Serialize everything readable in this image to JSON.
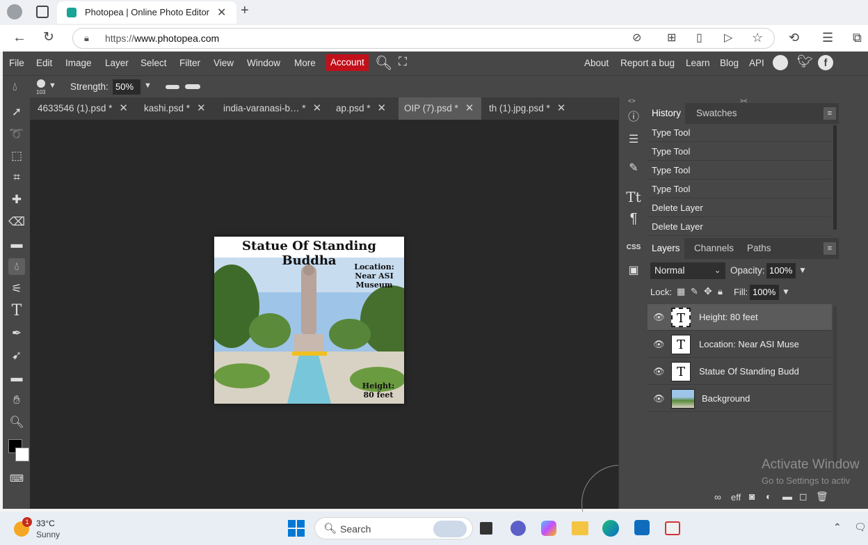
{
  "browser": {
    "tab_title": "Photopea | Online Photo Editor",
    "url_prefix": "https://",
    "url_domain": "www.photopea.com"
  },
  "menubar": {
    "items": [
      "File",
      "Edit",
      "Image",
      "Layer",
      "Select",
      "Filter",
      "View",
      "Window",
      "More"
    ],
    "account": "Account",
    "right_links": [
      "About",
      "Report a bug",
      "Learn",
      "Blog",
      "API"
    ]
  },
  "options": {
    "brush_size": "103",
    "strength_label": "Strength:",
    "strength_value": "50%"
  },
  "doc_tabs": [
    {
      "label": "4633546 (1).psd *"
    },
    {
      "label": "kashi.psd *"
    },
    {
      "label": "india-varanasi-b… *"
    },
    {
      "label": "ap.psd *"
    },
    {
      "label": "OIP (7).psd *"
    },
    {
      "label": "th (1).jpg.psd *"
    }
  ],
  "canvas_image": {
    "title": "Statue Of Standing Buddha",
    "location_line1": "Location:",
    "location_line2": "Near ASI",
    "location_line3": "Museum",
    "height_line1": "Height:",
    "height_line2": "80 feet"
  },
  "history_panel": {
    "tab_history": "History",
    "tab_swatches": "Swatches",
    "items": [
      "Type Tool",
      "Type Tool",
      "Type Tool",
      "Type Tool",
      "Delete Layer",
      "Delete Layer"
    ]
  },
  "layers_panel": {
    "tab_layers": "Layers",
    "tab_channels": "Channels",
    "tab_paths": "Paths",
    "blend_mode": "Normal",
    "opacity_label": "Opacity:",
    "opacity_value": "100%",
    "lock_label": "Lock:",
    "fill_label": "Fill:",
    "fill_value": "100%",
    "layers": [
      {
        "name": "Height: 80 feet",
        "type": "text"
      },
      {
        "name": "Location: Near ASI Muse",
        "type": "text"
      },
      {
        "name": "Statue Of Standing Budd",
        "type": "text"
      },
      {
        "name": "Background",
        "type": "image"
      }
    ],
    "footer_eff": "eff"
  },
  "watermark": {
    "line1": "Activate Window",
    "line2": "Go to Settings to activ"
  },
  "taskbar": {
    "temp": "33°C",
    "weather": "Sunny",
    "badge": "1",
    "search": "Search"
  },
  "colors": {
    "accent": "#c2101a",
    "app_bg": "#474747",
    "canvas_bg": "#282828"
  }
}
